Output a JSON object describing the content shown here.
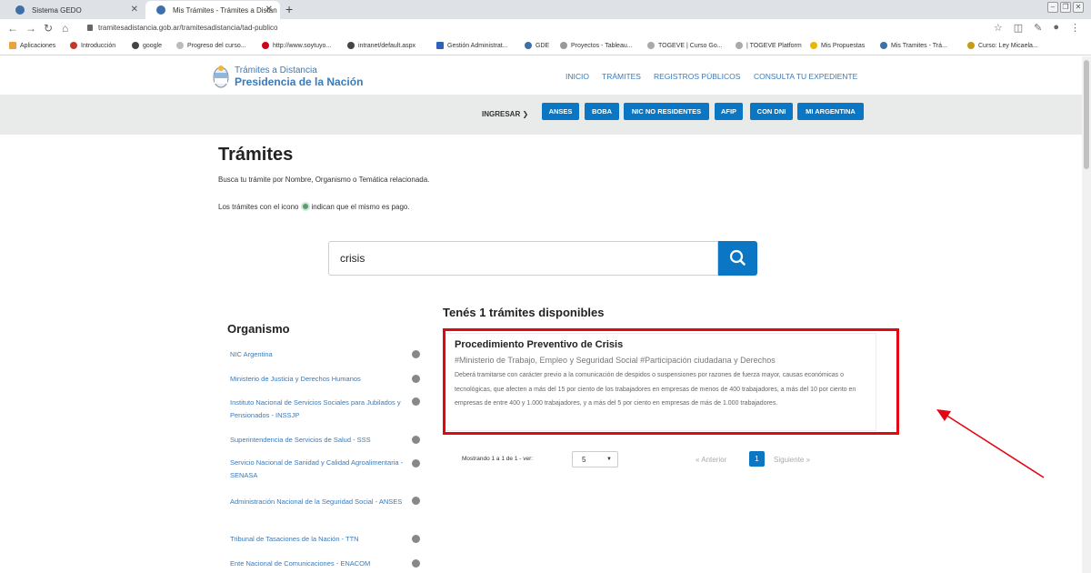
{
  "browser": {
    "tabs": [
      {
        "title": "Sistema GEDO"
      },
      {
        "title": "Mis Trámites - Trámites a Distan"
      }
    ],
    "url": "tramitesadistancia.gob.ar/tramitesadistancia/tad-publico",
    "bookmarks": [
      "Aplicaciones",
      "Introducción",
      "google",
      "Progreso del curso...",
      "http://www.soytuyo...",
      "intranet/default.aspx",
      "Gestión Administrat...",
      "GDE",
      "Proyectos - Tableau...",
      "TOGEVE | Curso Go...",
      "| TOGEVE Platform",
      "Mis Propuestas",
      "Mis Tramites - Trá...",
      "Curso: Ley Micaela..."
    ]
  },
  "site": {
    "logo_line1": "Trámites a Distancia",
    "logo_line2": "Presidencia de la Nación",
    "nav": [
      "INICIO",
      "TRÁMITES",
      "REGISTROS PÚBLICOS",
      "CONSULTA TU EXPEDIENTE"
    ],
    "ingresar_label": "INGRESAR ❯",
    "login_buttons": [
      "ANSES",
      "BOBA",
      "NIC NO RESIDENTES",
      "AFIP",
      "CON DNI",
      "MI ARGENTINA"
    ]
  },
  "main": {
    "title": "Trámites",
    "intro_search": "Busca tu trámite por Nombre, Organismo o Temática relacionada.",
    "intro_pay_before": "Los trámites con el icono",
    "intro_pay_after": "indican que el mismo es pago.",
    "search_value": "crisis",
    "results_title": "Tenés 1 trámites disponibles"
  },
  "organismo": {
    "title": "Organismo",
    "items": [
      "NIC Argentina",
      "Ministerio de Justicia y Derechos Humanos",
      "Instituto Nacional de Servicios Sociales para Jubilados y Pensionados - INSSJP",
      "Superintendencia de Servicios de Salud - SSS",
      "Servicio Nacional de Sanidad y Calidad Agroalimentaria - SENASA",
      "Administración Nacional de la Seguridad Social - ANSES",
      "Tribunal de Tasaciones de la Nación - TTN",
      "Ente Nacional de Comunicaciones - ENACOM"
    ]
  },
  "result": {
    "title": "Procedimiento Preventivo de Crisis",
    "tags": "#Ministerio de Trabajo, Empleo y Seguridad Social #Participación ciudadana y Derechos",
    "description": "Deberá tramitarse con carácter previo a la comunicación de despidos o suspensiones por razones de fuerza mayor, causas económicas o tecnológicas, que afecten a más del 15 por ciento de los trabajadores en empresas de menos de 400 trabajadores, a más del 10 por ciento en empresas de entre 400 y 1.000 trabajadores, y a más del 5 por ciento en empresas de más de 1.000 trabajadores."
  },
  "pagination": {
    "showing": "Mostrando 1 a 1 de 1 - ver:",
    "page_size": "5",
    "prev": "« Anterior",
    "current": "1",
    "next": "Siguiente »"
  },
  "colors": {
    "accent": "#0b76c3",
    "highlight": "#e30613",
    "link": "#3a7ab8"
  }
}
